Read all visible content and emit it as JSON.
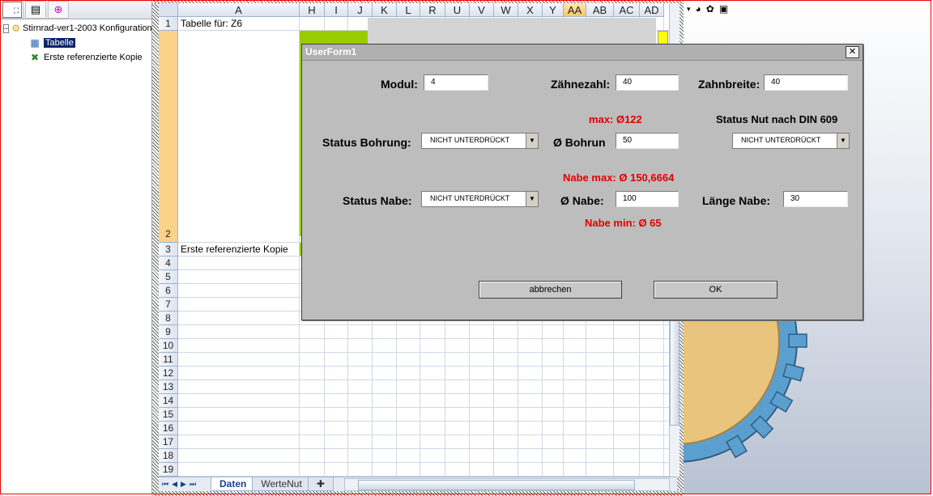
{
  "tree": {
    "root_label": "Stirnrad-ver1-2003 Konfiguration",
    "items": [
      {
        "label": "Tabelle",
        "selected": true
      },
      {
        "label": "Erste referenzierte Kopie",
        "selected": false
      }
    ]
  },
  "sheet": {
    "columns": [
      "A",
      "H",
      "I",
      "J",
      "K",
      "L",
      "R",
      "U",
      "V",
      "W",
      "X",
      "Y",
      "AA",
      "AB",
      "AC",
      "AD"
    ],
    "rows": [
      "1",
      "2",
      "3",
      "4",
      "5",
      "6",
      "7",
      "8",
      "9",
      "10",
      "11",
      "12",
      "13",
      "14",
      "15",
      "16",
      "17",
      "18",
      "19"
    ],
    "cells": {
      "a1": "Tabelle für: Z6",
      "a3": "Erste referenzierte Kopie"
    },
    "tabs": [
      "Daten",
      "WerteNut"
    ],
    "active_tab": "Daten"
  },
  "dialog": {
    "title": "UserForm1",
    "modul_label": "Modul:",
    "modul_value": "4",
    "zaehnezahl_label": "Zähnezahl:",
    "zaehnezahl_value": "40",
    "zahnbreite_label": "Zahnbreite:",
    "zahnbreite_value": "40",
    "max_bohrung": "max: Ø122",
    "status_nut_label": "Status Nut nach DIN 609",
    "status_bohrung_label": "Status Bohrung:",
    "status_bohrung_value": "NICHT UNTERDRÜCKT",
    "bohrung_label": "Ø Bohrun",
    "bohrung_value": "50",
    "status_nut_value": "NICHT UNTERDRÜCKT",
    "nabe_max": "Nabe max: Ø 150,6664",
    "status_nabe_label": "Status Nabe:",
    "status_nabe_value": "NICHT UNTERDRÜCKT",
    "nabe_label": "Ø Nabe:",
    "nabe_value": "100",
    "laenge_nabe_label": "Länge Nabe:",
    "laenge_nabe_value": "30",
    "nabe_min": "Nabe min: Ø 65",
    "cancel_label": "abbrechen",
    "ok_label": "OK",
    "close_label": "✕"
  },
  "colors": {
    "gear_blue": "#5b9fcf",
    "gear_tan": "#e8c47c",
    "warning_red": "#e00000",
    "green_cell": "#99cc00"
  }
}
